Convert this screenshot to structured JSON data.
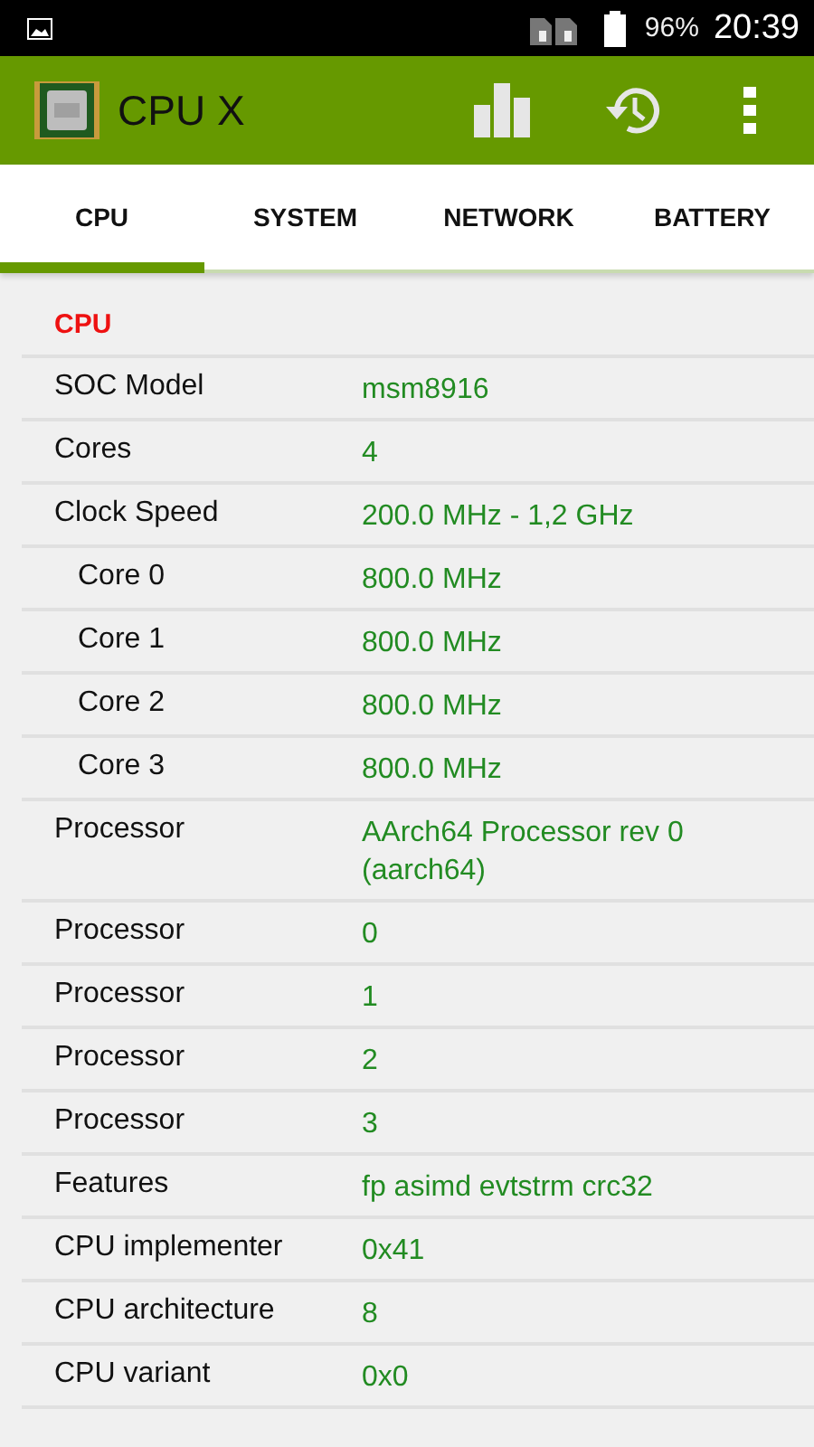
{
  "status_bar": {
    "battery": "96%",
    "time": "20:39"
  },
  "app_bar": {
    "title": "CPU X"
  },
  "tabs": [
    {
      "label": "CPU",
      "selected": true
    },
    {
      "label": "SYSTEM",
      "selected": false
    },
    {
      "label": "NETWORK",
      "selected": false
    },
    {
      "label": "BATTERY",
      "selected": false
    }
  ],
  "section": "CPU",
  "rows": [
    {
      "label": "SOC Model",
      "value": "msm8916",
      "kind": "main"
    },
    {
      "label": "Cores",
      "value": "4",
      "kind": "main"
    },
    {
      "label": "Clock Speed",
      "value": "200.0 MHz - 1,2 GHz",
      "kind": "main"
    },
    {
      "label": "Core 0",
      "value": "800.0 MHz",
      "kind": "sub"
    },
    {
      "label": "Core 1",
      "value": "800.0 MHz",
      "kind": "sub"
    },
    {
      "label": "Core 2",
      "value": "800.0 MHz",
      "kind": "sub"
    },
    {
      "label": "Core 3",
      "value": "800.0 MHz",
      "kind": "sub"
    },
    {
      "label": "Processor",
      "value": "AArch64 Processor rev 0 (aarch64)",
      "kind": "main"
    },
    {
      "label": "Processor",
      "value": "0",
      "kind": "main"
    },
    {
      "label": "Processor",
      "value": "1",
      "kind": "main"
    },
    {
      "label": "Processor",
      "value": "2",
      "kind": "main"
    },
    {
      "label": "Processor",
      "value": "3",
      "kind": "main"
    },
    {
      "label": "Features",
      "value": "fp asimd evtstrm crc32",
      "kind": "main"
    },
    {
      "label": "CPU implementer",
      "value": "0x41",
      "kind": "main"
    },
    {
      "label": "CPU architecture",
      "value": "8",
      "kind": "main"
    },
    {
      "label": "CPU variant",
      "value": "0x0",
      "kind": "main"
    }
  ]
}
